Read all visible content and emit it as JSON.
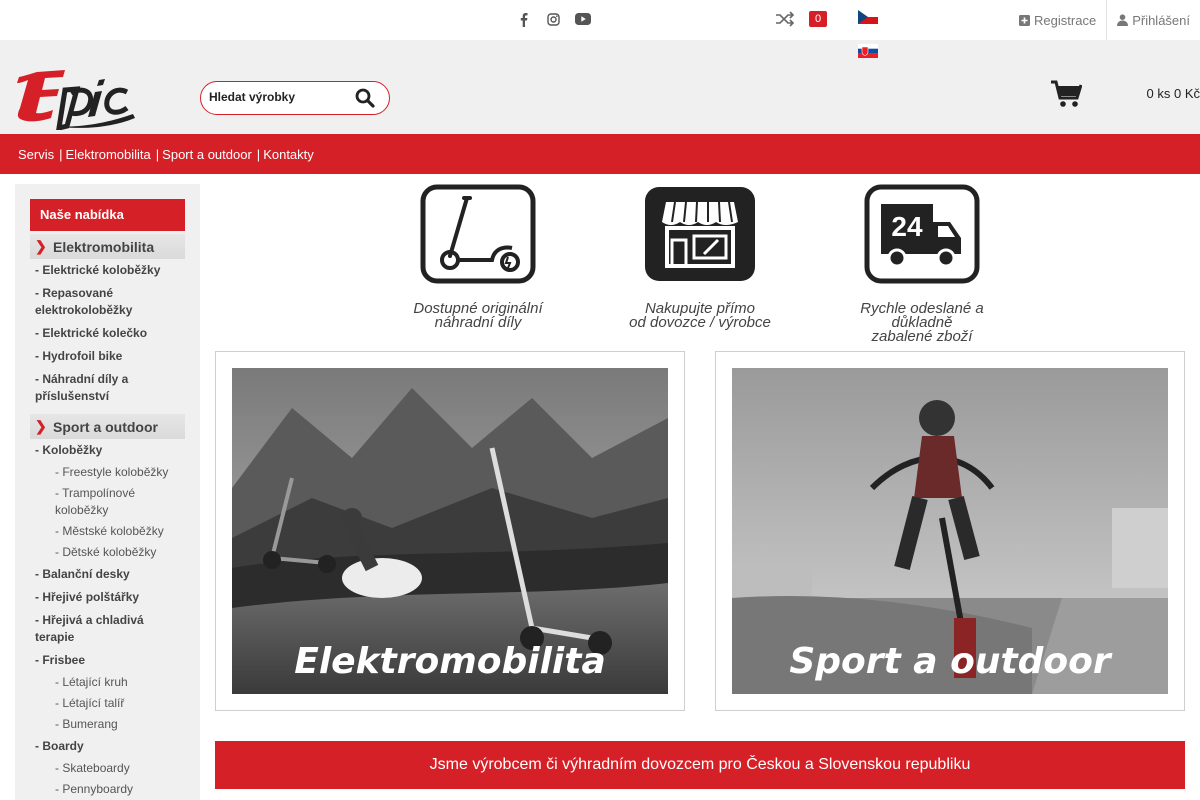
{
  "social": {
    "icons": [
      "facebook-icon",
      "instagram-icon",
      "youtube-icon"
    ]
  },
  "compare": {
    "count": "0"
  },
  "auth": {
    "register": "Registrace",
    "login": "Přihlášení"
  },
  "search": {
    "placeholder": "Hledat výrobky"
  },
  "cart": {
    "summary": "0 ks 0 Kč"
  },
  "nav": {
    "items": [
      "Servis",
      "Elektromobilita",
      "Sport a outdoor",
      "Kontakty"
    ],
    "separator": "|"
  },
  "sidebar": {
    "heading": "Naše nabídka",
    "sections": [
      {
        "title": "Elektromobilita",
        "items": [
          {
            "label": "- Elektrické koloběžky"
          },
          {
            "label": "- Repasované elektrokoloběžky"
          },
          {
            "label": "- Elektrické kolečko"
          },
          {
            "label": "- Hydrofoil bike"
          },
          {
            "label": "- Náhradní díly a příslušenství"
          }
        ]
      },
      {
        "title": "Sport a outdoor",
        "items": [
          {
            "label": "- Koloběžky",
            "sub": [
              "- Freestyle koloběžky",
              "- Trampolínové koloběžky",
              "- Městské koloběžky",
              "- Dětské koloběžky"
            ]
          },
          {
            "label": "- Balanční desky"
          },
          {
            "label": "- Hřejivé polštářky"
          },
          {
            "label": "- Hřejivá a chladivá terapie"
          },
          {
            "label": "- Frisbee",
            "sub": [
              "- Létající kruh",
              "- Létající talíř",
              "- Bumerang"
            ]
          },
          {
            "label": "- Boardy",
            "sub": [
              "- Skateboardy",
              "- Pennyboardy"
            ]
          }
        ]
      }
    ]
  },
  "features": [
    {
      "icon": "scooter-icon",
      "line1": "Dostupné originální",
      "line2": "náhradní díly"
    },
    {
      "icon": "shop-icon",
      "line1": "Nakupujte přímo",
      "line2": "od dovozce / výrobce"
    },
    {
      "icon": "delivery-24-icon",
      "line1": "Rychle odeslané a",
      "line2": "důkladně",
      "line3": "zabalené zboží",
      "badge": "24"
    }
  ],
  "banners": [
    {
      "caption": "Elektromobilita"
    },
    {
      "caption": "Sport a outdoor"
    }
  ],
  "info_bar": "Jsme výrobcem či výhradním dovozcem pro Českou a Slovenskou republiku",
  "colors": {
    "accent": "#d62027",
    "header_bg": "#f0f0f0"
  }
}
